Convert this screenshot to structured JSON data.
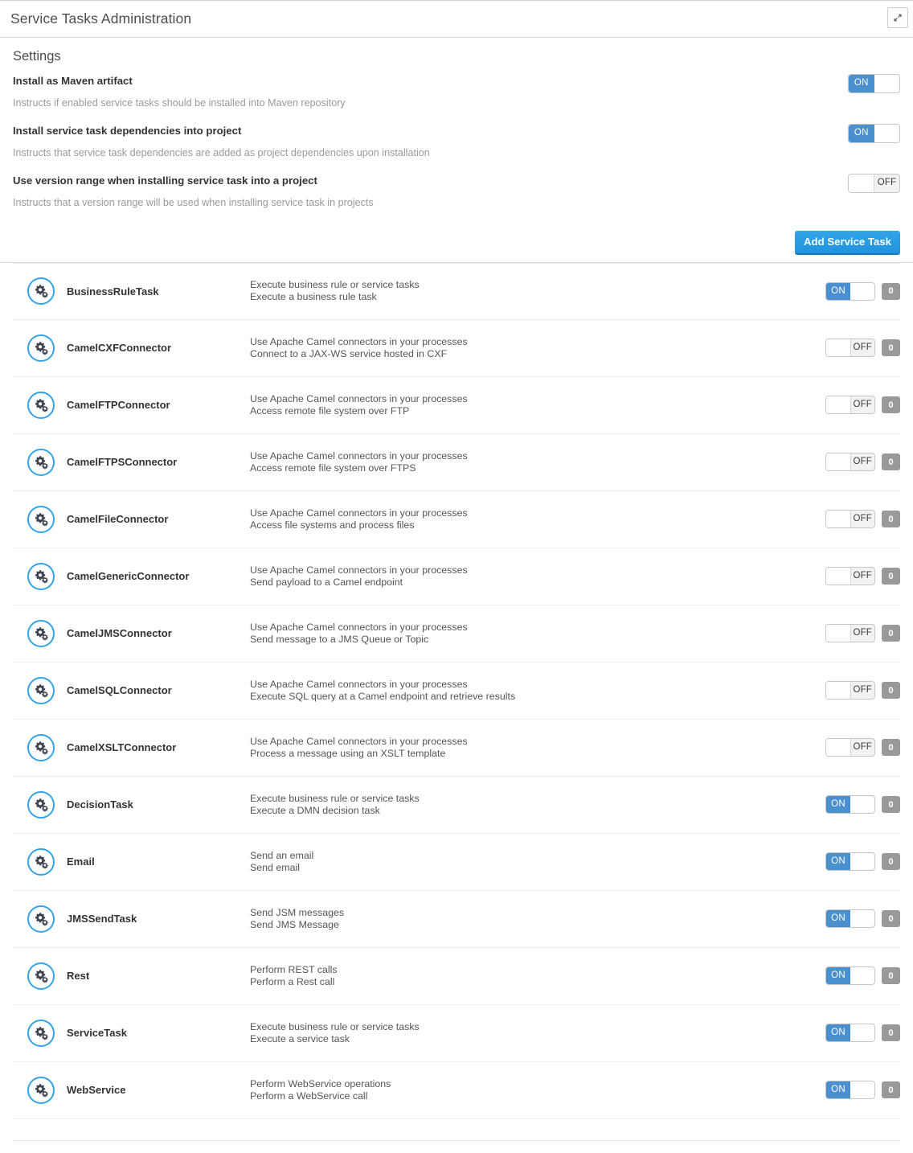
{
  "window": {
    "title": "Service Tasks Administration",
    "expand_icon": "expand-diagonal-icon"
  },
  "settings": {
    "title": "Settings",
    "rows": [
      {
        "label": "Install as Maven artifact",
        "description": "Instructs if enabled service tasks should be installed into Maven repository",
        "toggle": {
          "state": "on",
          "on_label": "ON",
          "off_label": "OFF"
        }
      },
      {
        "label": "Install service task dependencies into project",
        "description": "Instructs that service task dependencies are added as project dependencies upon installation",
        "toggle": {
          "state": "on",
          "on_label": "ON",
          "off_label": "OFF"
        }
      },
      {
        "label": "Use version range when installing service task into a project",
        "description": "Instructs that a version range will be used when installing service task in projects",
        "toggle": {
          "state": "off",
          "on_label": "ON",
          "off_label": "OFF"
        }
      }
    ]
  },
  "toolbar": {
    "add_service_task_label": "Add Service Task"
  },
  "task_list": {
    "icon": "gears-icon",
    "items": [
      {
        "name": "BusinessRuleTask",
        "desc_line1": "Execute business rule or service tasks",
        "desc_line2": "Execute a business rule task",
        "toggle": {
          "state": "on",
          "on_label": "ON",
          "off_label": "OFF"
        },
        "count": "0"
      },
      {
        "name": "CamelCXFConnector",
        "desc_line1": "Use Apache Camel connectors in your processes",
        "desc_line2": "Connect to a JAX-WS service hosted in CXF",
        "toggle": {
          "state": "off",
          "on_label": "ON",
          "off_label": "OFF"
        },
        "count": "0"
      },
      {
        "name": "CamelFTPConnector",
        "desc_line1": "Use Apache Camel connectors in your processes",
        "desc_line2": "Access remote file system over FTP",
        "toggle": {
          "state": "off",
          "on_label": "ON",
          "off_label": "OFF"
        },
        "count": "0"
      },
      {
        "name": "CamelFTPSConnector",
        "desc_line1": "Use Apache Camel connectors in your processes",
        "desc_line2": "Access remote file system over FTPS",
        "toggle": {
          "state": "off",
          "on_label": "ON",
          "off_label": "OFF"
        },
        "count": "0"
      },
      {
        "name": "CamelFileConnector",
        "desc_line1": "Use Apache Camel connectors in your processes",
        "desc_line2": "Access file systems and process files",
        "toggle": {
          "state": "off",
          "on_label": "ON",
          "off_label": "OFF"
        },
        "count": "0"
      },
      {
        "name": "CamelGenericConnector",
        "desc_line1": "Use Apache Camel connectors in your processes",
        "desc_line2": "Send payload to a Camel endpoint",
        "toggle": {
          "state": "off",
          "on_label": "ON",
          "off_label": "OFF"
        },
        "count": "0"
      },
      {
        "name": "CamelJMSConnector",
        "desc_line1": "Use Apache Camel connectors in your processes",
        "desc_line2": "Send message to a JMS Queue or Topic",
        "toggle": {
          "state": "off",
          "on_label": "ON",
          "off_label": "OFF"
        },
        "count": "0"
      },
      {
        "name": "CamelSQLConnector",
        "desc_line1": "Use Apache Camel connectors in your processes",
        "desc_line2": "Execute SQL query at a Camel endpoint and retrieve results",
        "toggle": {
          "state": "off",
          "on_label": "ON",
          "off_label": "OFF"
        },
        "count": "0"
      },
      {
        "name": "CamelXSLTConnector",
        "desc_line1": "Use Apache Camel connectors in your processes",
        "desc_line2": "Process a message using an XSLT template",
        "toggle": {
          "state": "off",
          "on_label": "ON",
          "off_label": "OFF"
        },
        "count": "0"
      },
      {
        "name": "DecisionTask",
        "desc_line1": "Execute business rule or service tasks",
        "desc_line2": "Execute a DMN decision task",
        "toggle": {
          "state": "on",
          "on_label": "ON",
          "off_label": "OFF"
        },
        "count": "0"
      },
      {
        "name": "Email",
        "desc_line1": "Send an email",
        "desc_line2": "Send email",
        "toggle": {
          "state": "on",
          "on_label": "ON",
          "off_label": "OFF"
        },
        "count": "0"
      },
      {
        "name": "JMSSendTask",
        "desc_line1": "Send JSM messages",
        "desc_line2": "Send JMS Message",
        "toggle": {
          "state": "on",
          "on_label": "ON",
          "off_label": "OFF"
        },
        "count": "0"
      },
      {
        "name": "Rest",
        "desc_line1": "Perform REST calls",
        "desc_line2": "Perform a Rest call",
        "toggle": {
          "state": "on",
          "on_label": "ON",
          "off_label": "OFF"
        },
        "count": "0"
      },
      {
        "name": "ServiceTask",
        "desc_line1": "Execute business rule or service tasks",
        "desc_line2": "Execute a service task",
        "toggle": {
          "state": "on",
          "on_label": "ON",
          "off_label": "OFF"
        },
        "count": "0"
      },
      {
        "name": "WebService",
        "desc_line1": "Perform WebService operations",
        "desc_line2": "Perform a WebService call",
        "toggle": {
          "state": "on",
          "on_label": "ON",
          "off_label": "OFF"
        },
        "count": "0"
      }
    ]
  },
  "colors": {
    "accent_blue": "#34a4e8",
    "toggle_on_blue": "#4a90cf",
    "badge_gray": "#999999",
    "text_dark": "#333333",
    "text_muted": "#9a9a9a"
  }
}
